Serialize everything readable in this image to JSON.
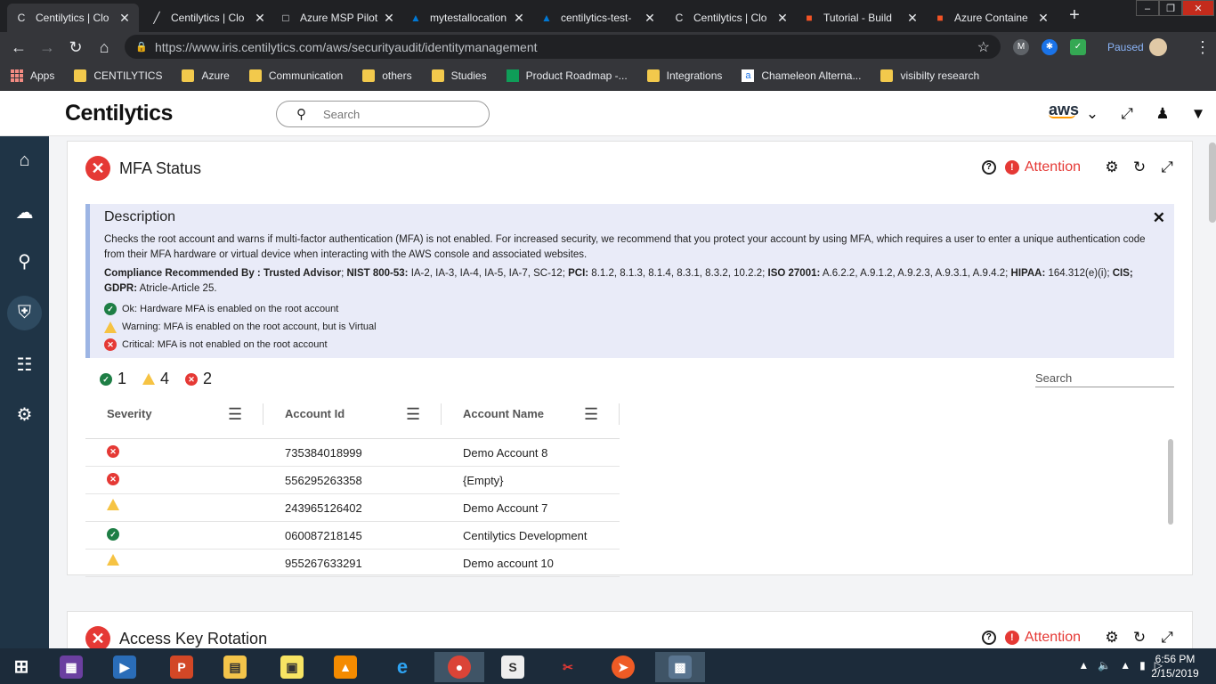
{
  "browser": {
    "tabs": [
      {
        "label": "Centilytics | Clo",
        "icon": "C",
        "color": "#e8eaed",
        "active": true
      },
      {
        "label": "Centilytics | Clo",
        "icon": "╱",
        "color": "#e8eaed"
      },
      {
        "label": "Azure MSP Pilot",
        "icon": "□",
        "color": "#e8eaed"
      },
      {
        "label": "mytestallocation",
        "icon": "▲",
        "color": "#0078d4"
      },
      {
        "label": "centilytics-test-",
        "icon": "▲",
        "color": "#0078d4"
      },
      {
        "label": "Centilytics | Clo",
        "icon": "C",
        "color": "#e8eaed"
      },
      {
        "label": "Tutorial - Build",
        "icon": "■",
        "color": "#f35325"
      },
      {
        "label": "Azure Containe",
        "icon": "■",
        "color": "#f35325"
      }
    ],
    "url": "https://www.iris.centilytics.com/aws/securityaudit/identitymanagement",
    "paused_label": "Paused",
    "bookmarks": [
      {
        "label": "Apps",
        "type": "apps"
      },
      {
        "label": "CENTILYTICS",
        "type": "folder"
      },
      {
        "label": "Azure",
        "type": "folder"
      },
      {
        "label": "Communication",
        "type": "folder"
      },
      {
        "label": "others",
        "type": "folder"
      },
      {
        "label": "Studies",
        "type": "folder"
      },
      {
        "label": "Product Roadmap -...",
        "type": "green"
      },
      {
        "label": "Integrations",
        "type": "folder"
      },
      {
        "label": "Chameleon Alterna...",
        "type": "a"
      },
      {
        "label": "visibilty research",
        "type": "folder"
      }
    ]
  },
  "header": {
    "logo": "Centilytics",
    "search_placeholder": "Search",
    "cloud": "aws"
  },
  "card1": {
    "title": "MFA Status",
    "attention": "Attention",
    "desc_title": "Description",
    "desc_text": "Checks the root account and warns if multi-factor authentication (MFA) is not enabled. For increased security, we recommend that you protect your account by using MFA, which requires a user to enter a unique authentication code from their MFA hardware or virtual device when interacting with the AWS console and associated websites.",
    "compliance_label": "Compliance Recommended By :",
    "compliance": [
      {
        "k": "Trusted Advisor",
        "v": ";"
      },
      {
        "k": "NIST 800-53:",
        "v": " IA-2, IA-3, IA-4, IA-5, IA-7, SC-12;"
      },
      {
        "k": "PCI:",
        "v": " 8.1.2, 8.1.3, 8.1.4, 8.3.1, 8.3.2, 10.2.2;"
      },
      {
        "k": "ISO 27001:",
        "v": " A.6.2.2, A.9.1.2, A.9.2.3, A.9.3.1, A.9.4.2;"
      },
      {
        "k": "HIPAA:",
        "v": " 164.312(e)(i); "
      },
      {
        "k": "CIS; GDPR:",
        "v": " Atricle-Article 25."
      }
    ],
    "legend": {
      "ok": "Ok: Hardware MFA is enabled on the root account",
      "warning": "Warning: MFA is enabled on the root account, but is Virtual",
      "critical": "Critical: MFA is not enabled on the root account"
    },
    "counts": {
      "ok": "1",
      "warning": "4",
      "critical": "2"
    },
    "table_search": "Search",
    "columns": [
      "Severity",
      "Account Id",
      "Account Name"
    ],
    "rows": [
      {
        "severity": "critical",
        "id": "735384018999",
        "name": "Demo Account 8"
      },
      {
        "severity": "critical",
        "id": "556295263358",
        "name": "{Empty}"
      },
      {
        "severity": "warning",
        "id": "243965126402",
        "name": "Demo Account 7"
      },
      {
        "severity": "ok",
        "id": "060087218145",
        "name": "Centilytics Development"
      },
      {
        "severity": "warning",
        "id": "955267633291",
        "name": "Demo account 10"
      }
    ]
  },
  "card2": {
    "title": "Access Key Rotation",
    "attention": "Attention"
  },
  "taskbar": {
    "time": "6:56 PM",
    "date": "2/15/2019"
  }
}
